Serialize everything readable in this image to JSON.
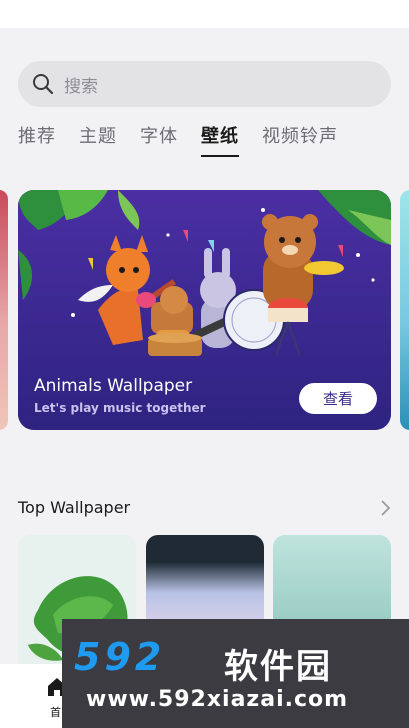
{
  "search": {
    "placeholder": "搜索"
  },
  "tabs": [
    {
      "label": "推荐"
    },
    {
      "label": "主题"
    },
    {
      "label": "字体"
    },
    {
      "label": "壁纸",
      "active": true
    },
    {
      "label": "视频铃声"
    }
  ],
  "banner": {
    "title": "Animals Wallpaper",
    "subtitle": "Let's play music together",
    "button": "查看"
  },
  "section": {
    "title": "Top Wallpaper"
  },
  "bottom_nav": {
    "home_label": "首"
  },
  "watermark": {
    "brand_digits": "592",
    "brand_cn": "软件园",
    "url": "www.592xiazai.com"
  },
  "colors": {
    "banner_bg": "#3d2a8f",
    "accent": "#1e9bf0"
  }
}
